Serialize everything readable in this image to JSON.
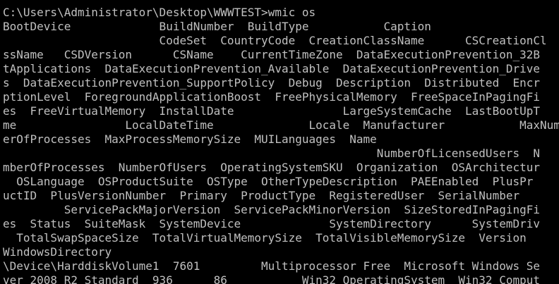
{
  "colors": {
    "background": "#000000",
    "text": "#c0c0c0"
  },
  "console": {
    "lines": [
      "C:\\Users\\Administrator\\Desktop\\WWWTEST>wmic os",
      "BootDevice             BuildNumber  BuildType           Caption",
      "                       CodeSet  CountryCode  CreationClassName      CSCreationCl",
      "ssName   CSDVersion      CSName    CurrentTimeZone  DataExecutionPrevention_32B",
      "tApplications  DataExecutionPrevention_Available  DataExecutionPrevention_Drive",
      "s  DataExecutionPrevention_SupportPolicy  Debug  Description  Distributed  Encr",
      "ptionLevel  ForegroundApplicationBoost  FreePhysicalMemory  FreeSpaceInPagingFi",
      "es  FreeVirtualMemory  InstallDate                LargeSystemCache  LastBootUpT",
      "me                LocalDateTime              Locale  Manufacturer           MaxNum",
      "erOfProcesses  MaxProcessMemorySize  MUILanguages  Name",
      "                                                       NumberOfLicensedUsers  N",
      "mberOfProcesses  NumberOfUsers  OperatingSystemSKU  Organization  OSArchitectur",
      "  OSLanguage  OSProductSuite  OSType  OtherTypeDescription  PAEEnabled  PlusPr",
      "uctID  PlusVersionNumber  Primary  ProductType  RegisteredUser  SerialNumber",
      "         ServicePackMajorVersion  ServicePackMinorVersion  SizeStoredInPagingFi",
      "es  Status  SuiteMask  SystemDevice             SystemDirectory      SystemDriv",
      "  TotalSwapSpaceSize  TotalVirtualMemorySize  TotalVisibleMemorySize  Version",
      "WindowsDirectory",
      "\\Device\\HarddiskVolume1  7601         Multiprocessor Free  Microsoft Windows Se",
      "ver 2008 R2 Standard  936      86           Win32_OperatingSystem  Win32_Comput"
    ]
  }
}
